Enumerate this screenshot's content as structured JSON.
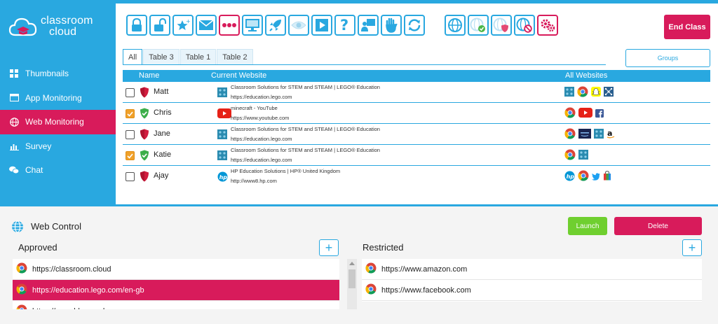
{
  "app": {
    "logo_text_1": "classroom",
    "logo_text_2": "cloud"
  },
  "sidebar": {
    "items": [
      {
        "label": "Thumbnails",
        "icon": "grid-icon",
        "active": false
      },
      {
        "label": "App Monitoring",
        "icon": "window-icon",
        "active": false
      },
      {
        "label": "Web Monitoring",
        "icon": "globe-icon",
        "active": true
      },
      {
        "label": "Survey",
        "icon": "bar-chart-icon",
        "active": false
      },
      {
        "label": "Chat",
        "icon": "chat-bubbles-icon",
        "active": false
      }
    ]
  },
  "toolbar": {
    "buttons": [
      "lock-icon",
      "unlock-icon",
      "star-icon",
      "mail-icon",
      "dots-icon",
      "monitor-icon",
      "rocket-icon",
      "eye-icon",
      "play-icon",
      "question-icon",
      "presenter-icon",
      "hand-icon",
      "refresh-icon",
      "globe-icon",
      "globe-approved-icon",
      "globe-shield-icon",
      "globe-blocked-icon",
      "settings-icon"
    ],
    "end_class_label": "End Class"
  },
  "tabs": {
    "items": [
      "All",
      "Table 3",
      "Table 1",
      "Table 2"
    ],
    "active": "All"
  },
  "groups_label": "Groups",
  "table": {
    "headers": {
      "name": "Name",
      "current_website": "Current Website",
      "all_websites": "All Websites"
    },
    "rows": [
      {
        "name": "Matt",
        "checked": false,
        "status": "blocked",
        "site_icon": "lego-icon",
        "title": "Classroom Solutions for STEM and STEAM | LEGO® Education",
        "url": "https://education.lego.com",
        "all_sites": [
          "lego-icon",
          "chrome-icon",
          "snapchat-icon",
          "network-icon"
        ]
      },
      {
        "name": "Chris",
        "checked": true,
        "status": "allowed",
        "site_icon": "youtube-icon",
        "title": "minecraft - YouTube",
        "url": "https://www.youtube.com",
        "all_sites": [
          "chrome-icon",
          "youtube-icon",
          "facebook-icon"
        ]
      },
      {
        "name": "Jane",
        "checked": false,
        "status": "blocked",
        "site_icon": "lego-icon",
        "title": "Classroom Solutions for STEM and STEAM | LEGO® Education",
        "url": "https://education.lego.com",
        "all_sites": [
          "chrome-icon",
          "amazon-prime-icon",
          "lego-icon",
          "amazon-icon"
        ]
      },
      {
        "name": "Katie",
        "checked": true,
        "status": "allowed",
        "site_icon": "lego-icon",
        "title": "Classroom Solutions for STEM and STEAM | LEGO® Education",
        "url": "https://education.lego.com",
        "all_sites": [
          "chrome-icon",
          "lego-icon"
        ]
      },
      {
        "name": "Ajay",
        "checked": false,
        "status": "blocked",
        "site_icon": "hp-icon",
        "title": "HP Education Solutions | HP® United Kingdom",
        "url": "http://www8.hp.com",
        "all_sites": [
          "hp-icon",
          "chrome-icon",
          "twitter-icon",
          "shopping-bag-icon"
        ]
      }
    ]
  },
  "web_control": {
    "title": "Web Control",
    "launch_label": "Launch",
    "delete_label": "Delete",
    "approved": {
      "title": "Approved",
      "add_label": "+",
      "items": [
        "https://classroom.cloud",
        "https://education.lego.com/en-gb",
        "https://www.bbc.co.uk"
      ],
      "selected": "https://education.lego.com/en-gb"
    },
    "restricted": {
      "title": "Restricted",
      "add_label": "+",
      "items": [
        "https://www.amazon.com",
        "https://www.facebook.com"
      ]
    }
  },
  "colors": {
    "accent": "#29a8e0",
    "brand_pink": "#d81b5b",
    "launch_green": "#6fcf2f",
    "check_orange": "#f0a12b"
  }
}
